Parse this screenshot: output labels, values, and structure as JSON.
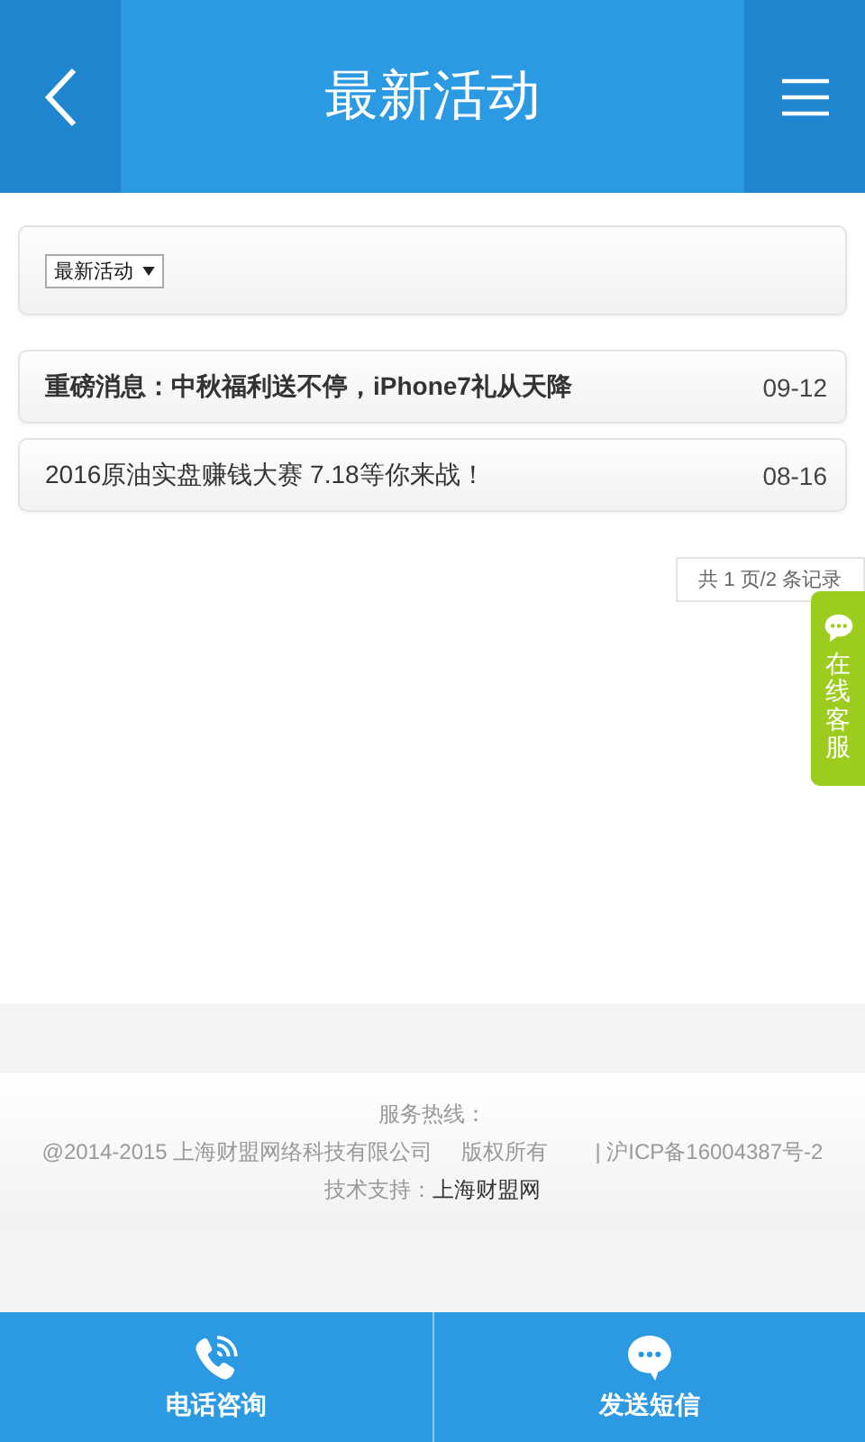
{
  "header": {
    "title": "最新活动"
  },
  "filter": {
    "value": "最新活动"
  },
  "articles": [
    {
      "title": "重磅消息：中秋福利送不停，iPhone7礼从天降",
      "date": "09-12",
      "emphasized": true
    },
    {
      "title": "2016原油实盘赚钱大赛 7.18等你来战！",
      "date": "08-16",
      "emphasized": false
    }
  ],
  "pager": "共 1 页/2 条记录",
  "chat_tab": "在线客服",
  "footer": {
    "hotline_label": "服务热线：",
    "copyright": "@2014-2015 上海财盟网络科技有限公司",
    "rights": "版权所有",
    "icp": "| 沪ICP备16004387号-2",
    "support_label": "技术支持：",
    "support_link": "上海财盟网"
  },
  "bottom_nav": [
    {
      "kind": "phone",
      "label": "电话咨询"
    },
    {
      "kind": "message",
      "label": "发送短信"
    }
  ]
}
